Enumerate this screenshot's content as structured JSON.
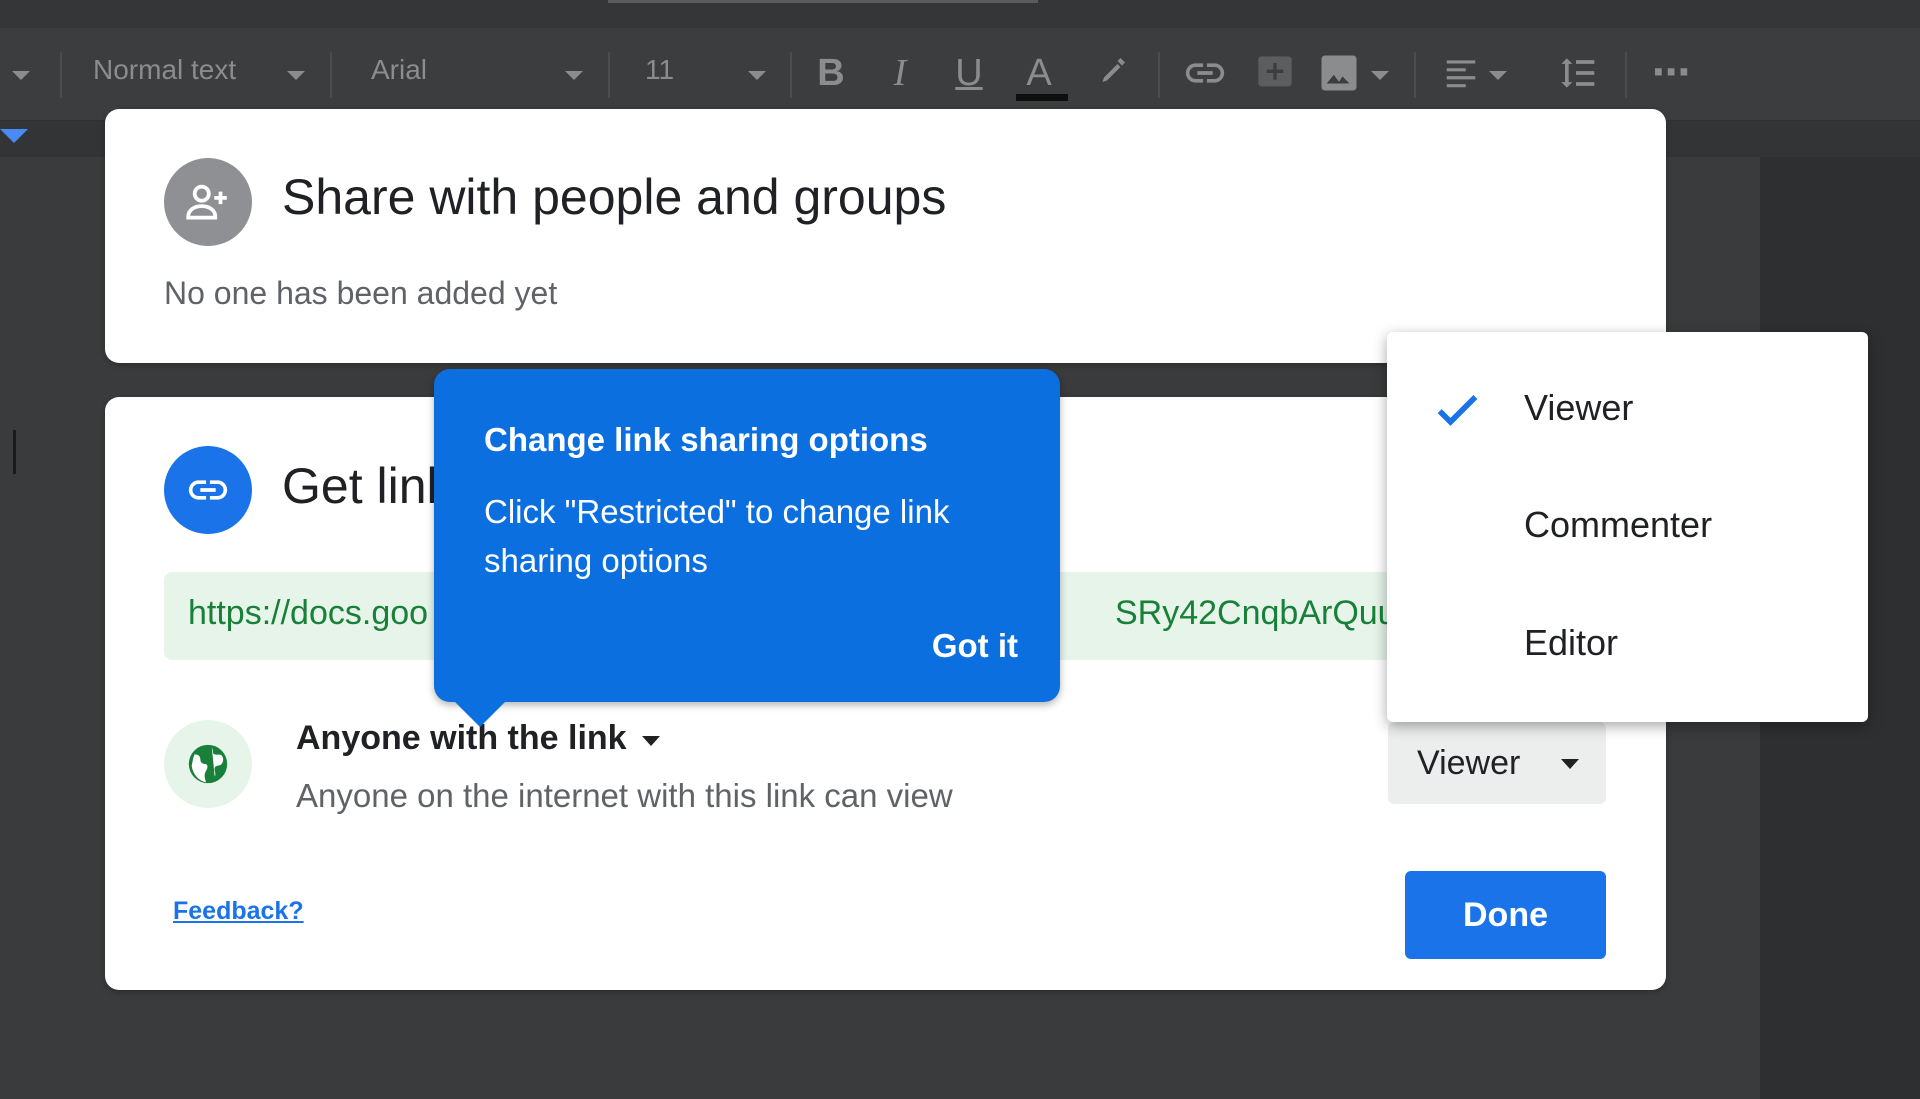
{
  "toolbar": {
    "style": "Normal text",
    "font": "Arial",
    "size": "11",
    "bold": "B",
    "italic": "I",
    "underline": "U",
    "text_color": "A",
    "more": "⋯"
  },
  "share_card": {
    "title": "Share with people and groups",
    "subtitle": "No one has been added yet"
  },
  "link_card": {
    "title": "Get link",
    "url_start": "https://docs.goo",
    "url_end": "SRy42CnqbArQuuSz…",
    "access_title": "Anyone with the link",
    "access_desc": "Anyone on the internet with this link can view",
    "role": "Viewer",
    "feedback": "Feedback?",
    "done": "Done"
  },
  "tooltip": {
    "title": "Change link sharing options",
    "body": "Click \"Restricted\" to change link sharing options",
    "button": "Got it"
  },
  "role_menu": {
    "items": [
      "Viewer",
      "Commenter",
      "Editor"
    ],
    "selected": "Viewer"
  },
  "colors": {
    "accent": "#1a73e8",
    "link_green": "#188038",
    "link_bg": "#e6f4ea",
    "tooltip_bg": "#0b6fe0"
  }
}
